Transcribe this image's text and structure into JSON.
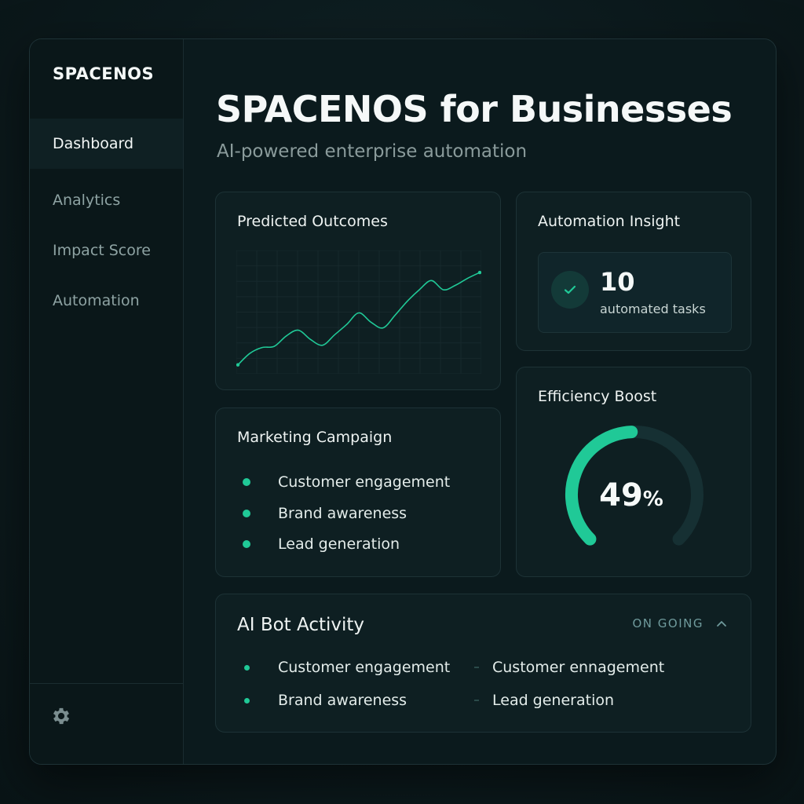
{
  "app": {
    "logo": "SPACENOS"
  },
  "sidebar": {
    "items": [
      {
        "label": "Dashboard",
        "active": true
      },
      {
        "label": "Analytics",
        "active": false
      },
      {
        "label": "Impact Score",
        "active": false
      },
      {
        "label": "Automation",
        "active": false
      }
    ],
    "settings_icon": "gear-icon"
  },
  "header": {
    "title": "SPACENOS for Businesses",
    "subtitle": "AI-powered enterprise automation"
  },
  "predicted_outcomes": {
    "title": "Predicted Outcomes"
  },
  "automation_insight": {
    "title": "Automation Insight",
    "count": "10",
    "label": "automated tasks",
    "icon": "check-icon"
  },
  "marketing_campaign": {
    "title": "Marketing Campaign",
    "items": [
      "Customer engagement",
      "Brand awareness",
      "Lead generation"
    ]
  },
  "efficiency_boost": {
    "title": "Efficiency Boost",
    "value": "49",
    "unit": "%",
    "fraction": 0.49
  },
  "ai_bot_activity": {
    "title": "AI Bot Activity",
    "status": "ON GOING",
    "left_items": [
      "Customer engagement",
      "Brand awareness"
    ],
    "right_items": [
      "Customer ennagement",
      "Lead generation"
    ]
  },
  "colors": {
    "accent": "#20c997",
    "background": "#0b1a1d",
    "card": "#0e1f22"
  },
  "chart_data": {
    "type": "line",
    "title": "Predicted Outcomes",
    "xlabel": "",
    "ylabel": "",
    "grid": true,
    "x": [
      0,
      1,
      2,
      3,
      4,
      5,
      6,
      7,
      8,
      9,
      10,
      11,
      12,
      13,
      14,
      15,
      16,
      17,
      18,
      19,
      20
    ],
    "values": [
      5,
      15,
      20,
      21,
      30,
      35,
      27,
      22,
      31,
      40,
      50,
      42,
      37,
      48,
      60,
      70,
      78,
      70,
      74,
      80,
      85
    ],
    "ylim": [
      0,
      100
    ]
  }
}
